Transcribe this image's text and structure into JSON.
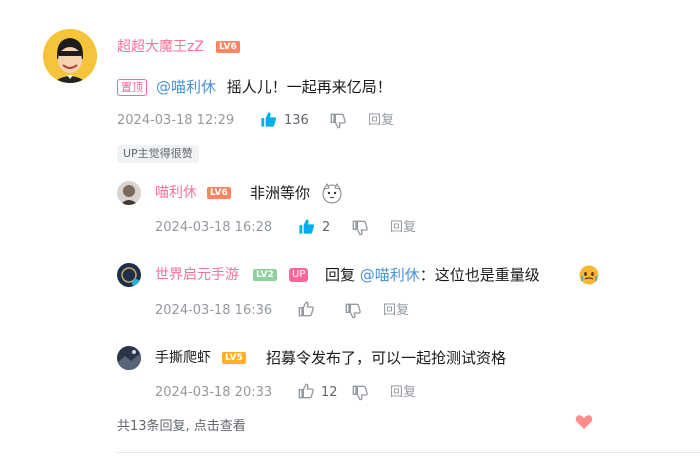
{
  "colors": {
    "username_pink": "#fb7299",
    "mention_blue": "#4793d6",
    "like_active_blue": "#00aeec",
    "meta_gray": "#9499a0"
  },
  "main_comment": {
    "username": "超超大魔王zZ",
    "level": "LV6",
    "pinned_label": "置顶",
    "mention": "@喵利休",
    "text": "摇人儿！一起再来亿局！",
    "timestamp": "2024-03-18 12:29",
    "likes": "136",
    "reply_label": "回复",
    "up_liked_label": "UP主觉得很赞"
  },
  "replies": [
    {
      "username": "喵利休",
      "level": "LV6",
      "text": "非洲等你",
      "timestamp": "2024-03-18 16:28",
      "likes": "2",
      "reply_label": "回复",
      "liked": true
    },
    {
      "username": "世界启元手游",
      "level": "LV2",
      "up_tag": "UP",
      "prefix": "回复 ",
      "mention": "@喵利休",
      "text": "：这位也是重量级",
      "timestamp": "2024-03-18 16:36",
      "likes": "",
      "reply_label": "回复",
      "liked": false
    },
    {
      "username": "手撕爬虾",
      "level": "LV5",
      "text": "招募令发布了，可以一起抢测试资格",
      "timestamp": "2024-03-18 20:33",
      "likes": "12",
      "reply_label": "回复",
      "liked": false
    }
  ],
  "footer": {
    "more_replies": "共13条回复, 点击查看"
  }
}
